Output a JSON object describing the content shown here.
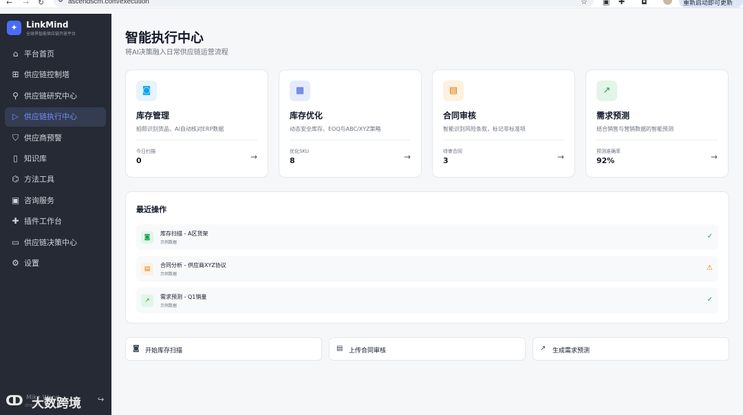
{
  "browser": {
    "url": "ascendscm.com/execution",
    "update_label": "重新启动即可更新"
  },
  "sidebar": {
    "brand_name": "LinkMind",
    "brand_sub": "全球界智能供应链开放平台",
    "items": [
      {
        "label": "平台首页",
        "icon": "home-icon"
      },
      {
        "label": "供应链控制塔",
        "icon": "grid-icon"
      },
      {
        "label": "供应链研究中心",
        "icon": "search-icon"
      },
      {
        "label": "供应链执行中心",
        "icon": "play-icon",
        "active": true
      },
      {
        "label": "供应商预警",
        "icon": "shield-icon"
      },
      {
        "label": "知识库",
        "icon": "book-icon"
      },
      {
        "label": "方法工具",
        "icon": "graduation-cap-icon"
      },
      {
        "label": "咨询服务",
        "icon": "briefcase-icon"
      },
      {
        "label": "插件工作台",
        "icon": "puzzle-icon"
      },
      {
        "label": "供应链决策中心",
        "icon": "monitor-icon"
      },
      {
        "label": "设置",
        "icon": "gear-icon"
      }
    ],
    "footer": {
      "user": "Mike Wang",
      "sub": "dream",
      "watermark": "大数跨境"
    }
  },
  "page": {
    "title": "智能执行中心",
    "subtitle": "将AI决策融入日常供应链运营流程"
  },
  "cards": [
    {
      "title": "库存管理",
      "desc": "拍照识别货品，AI自动核对ERP数据",
      "stat_label": "今日扫描",
      "stat_value": "0",
      "icon": "camera-icon",
      "color": "#0ea5e9",
      "bg": "#e6f4fb"
    },
    {
      "title": "库存优化",
      "desc": "动态安全库存、EOQ与ABC/XYZ策略",
      "stat_label": "优化SKU",
      "stat_value": "8",
      "icon": "calculator-icon",
      "color": "#3b5bdb",
      "bg": "#e5ebfb"
    },
    {
      "title": "合同审核",
      "desc": "智能识别风险条款，标记非标准项",
      "stat_label": "待审合同",
      "stat_value": "3",
      "icon": "document-icon",
      "color": "#d97706",
      "bg": "#fdf1e0"
    },
    {
      "title": "需求预测",
      "desc": "结合销售与营销数据的智能预测",
      "stat_label": "预测准确率",
      "stat_value": "92%",
      "icon": "trend-up-icon",
      "color": "#16a34a",
      "bg": "#e3f5e8"
    }
  ],
  "recent": {
    "title": "最近操作",
    "ops": [
      {
        "name": "库存扫描 - A区货架",
        "meta": "示例数据",
        "icon": "camera-icon",
        "status": "success",
        "color": "#16a34a",
        "bg": "#e3f5e8"
      },
      {
        "name": "合同分析 - 供应商XYZ协议",
        "meta": "示例数据",
        "icon": "document-icon",
        "status": "warning",
        "color": "#d97706",
        "bg": "#fdf1e0"
      },
      {
        "name": "需求预测 - Q1销量",
        "meta": "示例数据",
        "icon": "trend-up-icon",
        "status": "success",
        "color": "#16a34a",
        "bg": "#e3f5e8"
      }
    ]
  },
  "actions": [
    {
      "label": "开始库存扫描",
      "icon": "camera-icon"
    },
    {
      "label": "上传合同审核",
      "icon": "document-icon"
    },
    {
      "label": "生成需求预测",
      "icon": "trend-up-icon"
    }
  ]
}
